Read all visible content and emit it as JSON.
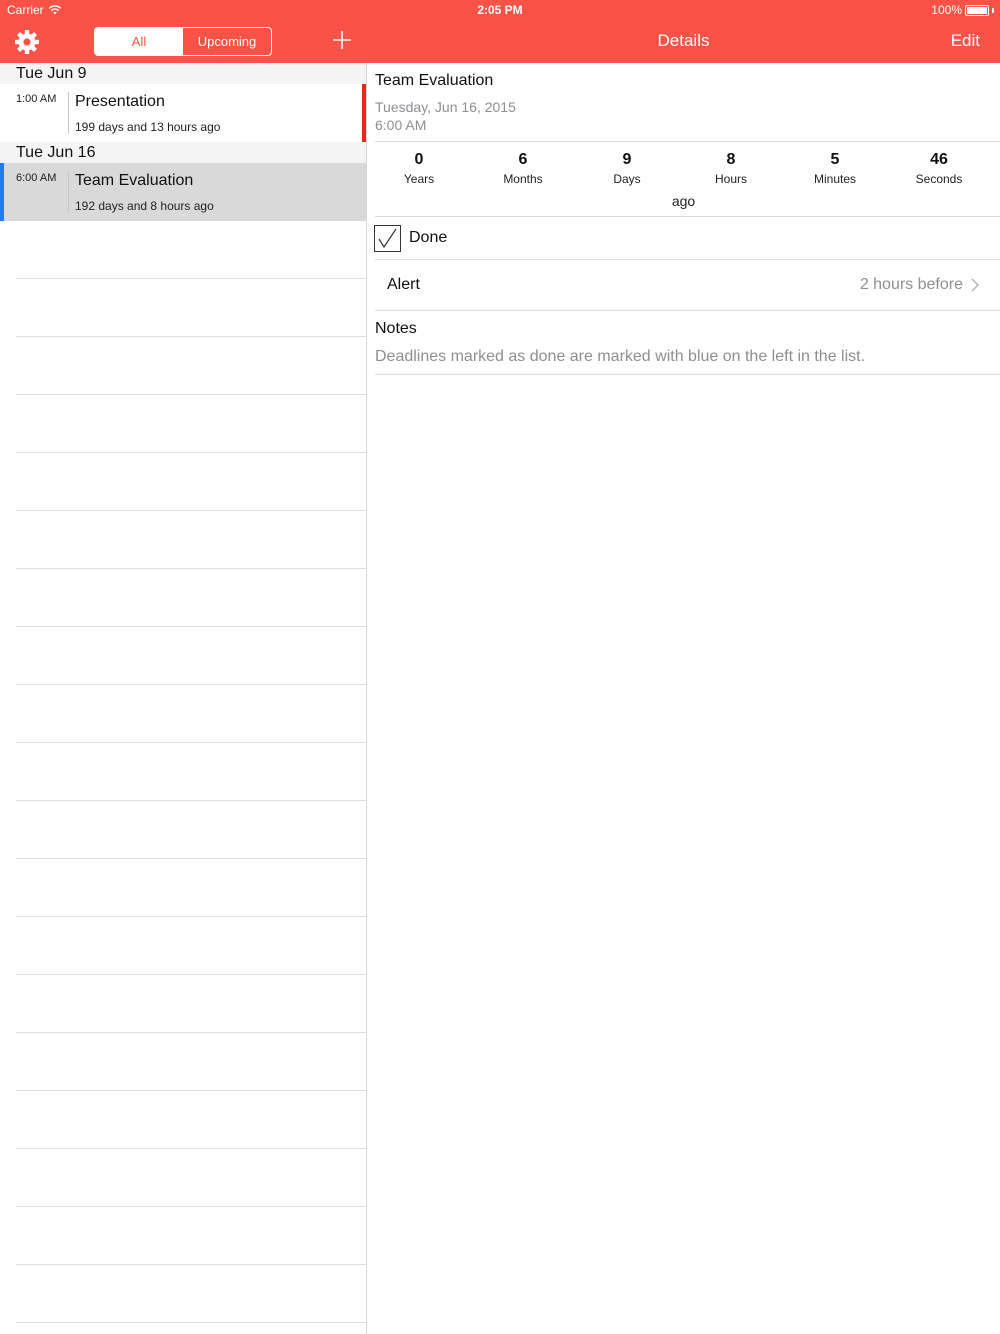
{
  "status_bar": {
    "carrier": "Carrier",
    "time": "2:05 PM",
    "battery": "100%"
  },
  "toolbar": {
    "segments": [
      "All",
      "Upcoming"
    ],
    "selected_segment": "All",
    "details_title": "Details",
    "edit_label": "Edit"
  },
  "list": {
    "sections": [
      {
        "header": "Tue  Jun 9",
        "items": [
          {
            "time": "1:00 AM",
            "title": "Presentation",
            "subtitle": "199 days and 13 hours ago",
            "marker": "red"
          }
        ]
      },
      {
        "header": "Tue  Jun 16",
        "items": [
          {
            "time": "6:00 AM",
            "title": "Team Evaluation",
            "subtitle": "192 days and 8 hours ago",
            "marker": "blue",
            "selected": true
          }
        ]
      }
    ]
  },
  "details": {
    "title": "Team Evaluation",
    "date": "Tuesday, Jun 16, 2015",
    "time": "6:00 AM",
    "counters": [
      {
        "value": "0",
        "label": "Years"
      },
      {
        "value": "6",
        "label": "Months"
      },
      {
        "value": "9",
        "label": "Days"
      },
      {
        "value": "8",
        "label": "Hours"
      },
      {
        "value": "5",
        "label": "Minutes"
      },
      {
        "value": "46",
        "label": "Seconds"
      }
    ],
    "ago": "ago",
    "done_label": "Done",
    "done_checked": true,
    "alert_label": "Alert",
    "alert_value": "2 hours before",
    "notes_label": "Notes",
    "notes_text": "Deadlines marked as done are marked with blue on the left in the list."
  },
  "colors": {
    "accent": "#fa5246",
    "marker_red": "#e8281c",
    "marker_blue": "#1d7bf2"
  }
}
